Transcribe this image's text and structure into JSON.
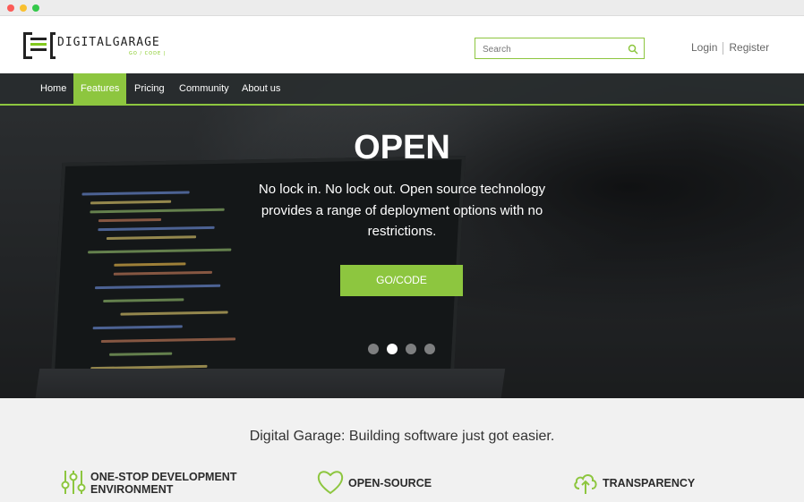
{
  "window": {
    "controls": [
      "close",
      "minimize",
      "maximize"
    ]
  },
  "brand": {
    "name": "DIGITALGARAGE",
    "sub": "GO / CODE |"
  },
  "search": {
    "placeholder": "Search"
  },
  "auth": {
    "login": "Login",
    "register": "Register"
  },
  "nav": {
    "items": [
      {
        "label": "Home",
        "active": false
      },
      {
        "label": "Features",
        "active": true
      },
      {
        "label": "Pricing",
        "active": false
      },
      {
        "label": "Community",
        "active": false
      },
      {
        "label": "About us",
        "active": false
      }
    ]
  },
  "hero": {
    "title": "OPEN",
    "line1": "No lock in. No lock out. Open source technology",
    "line2": "provides a range of deployment options with no",
    "line3": "restrictions.",
    "button": "GO/CODE",
    "slides": 4,
    "active_slide": 2
  },
  "tagline": "Digital Garage: Building software just got easier.",
  "features": [
    {
      "icon": "sliders-icon",
      "line1": "ONE-STOP DEVELOPMENT",
      "line2": "ENVIRONMENT"
    },
    {
      "icon": "heart-icon",
      "line1": "OPEN-SOURCE",
      "line2": ""
    },
    {
      "icon": "cloud-upload-icon",
      "line1": "TRANSPARENCY",
      "line2": ""
    }
  ],
  "colors": {
    "accent": "#8dc63f",
    "nav_bg": "#2c2f31",
    "text_dark": "#2b2b2b"
  }
}
